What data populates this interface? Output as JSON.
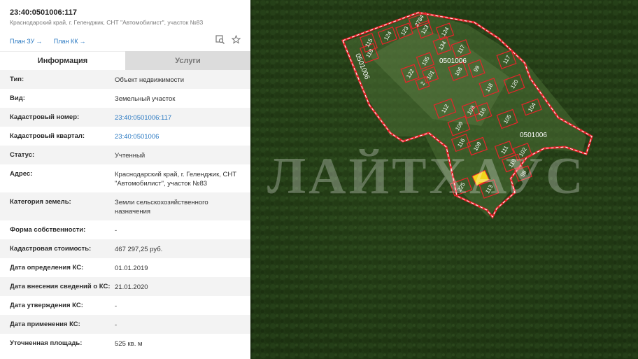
{
  "header": {
    "cadastral_number": "23:40:0501006:117",
    "address": "Краснодарский край, г. Геленджик, СНТ \"Автомобилист\", участок №83",
    "link_plan_zu": "План ЗУ",
    "link_plan_kk": "План КК",
    "arrow": "→"
  },
  "tabs": [
    {
      "label": "Информация",
      "active": true
    },
    {
      "label": "Услуги",
      "active": false
    }
  ],
  "rows": [
    {
      "key": "Тип:",
      "value": "Объект недвижимости"
    },
    {
      "key": "Вид:",
      "value": "Земельный участок"
    },
    {
      "key": "Кадастровый номер:",
      "value": "23:40:0501006:117"
    },
    {
      "key": "Кадастровый квартал:",
      "value": "23:40:0501006"
    },
    {
      "key": "Статус:",
      "value": "Учтенный"
    },
    {
      "key": "Адрес:",
      "value": "Краснодарский край, г. Геленджик, СНТ \"Автомобилист\", участок №83"
    },
    {
      "key": "Категория земель:",
      "value": "Земли сельскохозяйственного назначения"
    },
    {
      "key": "Форма собственности:",
      "value": "-"
    },
    {
      "key": "Кадастровая стоимость:",
      "value": "467 297,25 руб."
    },
    {
      "key": "Дата определения КС:",
      "value": "01.01.2019"
    },
    {
      "key": "Дата внесения сведений о КС:",
      "value": "21.01.2020"
    },
    {
      "key": "Дата утверждения КС:",
      "value": "-"
    },
    {
      "key": "Дата применения КС:",
      "value": "-"
    },
    {
      "key": "Уточненная площадь:",
      "value": "525 кв. м"
    }
  ],
  "map": {
    "watermark": "ЛАЙТХАУС",
    "quarter_labels": [
      "0501006",
      "0501006",
      "0501006"
    ],
    "plot_labels": [
      "2784",
      "124",
      "123",
      "123",
      "115",
      "124",
      "117",
      "134",
      "122",
      "135",
      "101",
      "2",
      "106",
      "99",
      "118",
      "116",
      "104",
      "112",
      "103",
      "105",
      "109",
      "116",
      "109",
      "111",
      "102",
      "119",
      "98",
      "113",
      "225",
      "117",
      "120",
      "118"
    ]
  },
  "colors": {
    "link": "#2a79c2",
    "boundary": "#e8242b",
    "selected_plot": "#f2d51c"
  }
}
